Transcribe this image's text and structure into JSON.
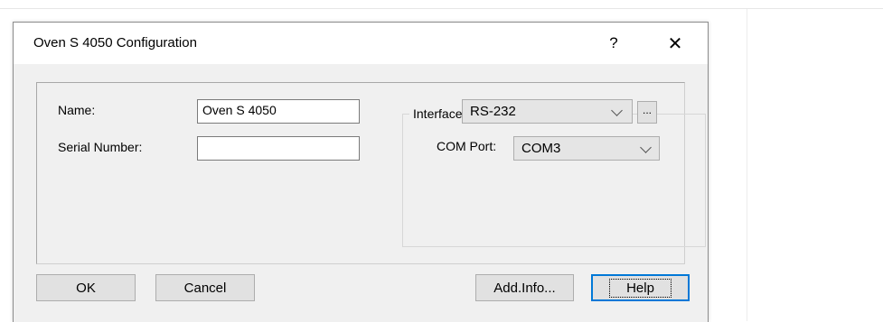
{
  "dialog": {
    "title": "Oven S 4050 Configuration",
    "help_glyph": "?",
    "close_glyph": "✕"
  },
  "form": {
    "name_label": "Name:",
    "name_value": "Oven S 4050",
    "serial_label": "Serial Number:",
    "serial_value": "",
    "interface_label": "Interface:",
    "interface_value": "RS-232",
    "interface_more": "...",
    "com_label": "COM Port:",
    "com_value": "COM3"
  },
  "buttons": {
    "ok": "OK",
    "cancel": "Cancel",
    "add_info": "Add.Info...",
    "help": "Help"
  }
}
